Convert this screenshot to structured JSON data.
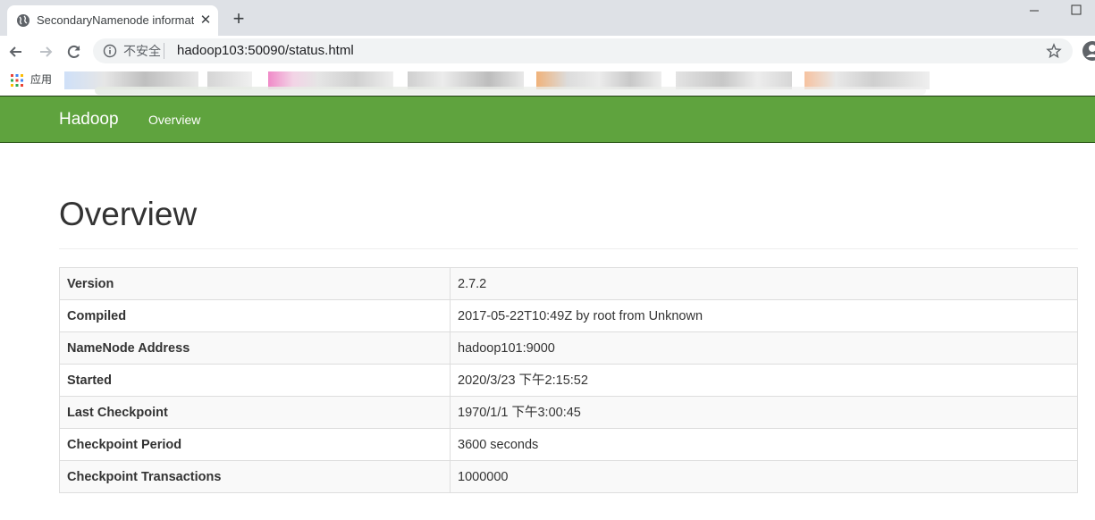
{
  "browser": {
    "tab_title": "SecondaryNamenode information",
    "security_label": "不安全",
    "url": "hadoop103:50090/status.html",
    "bookmarks": {
      "apps_label": "应用"
    }
  },
  "navbar": {
    "brand": "Hadoop",
    "links": [
      {
        "label": "Overview"
      }
    ]
  },
  "overview": {
    "title": "Overview",
    "rows": [
      {
        "label": "Version",
        "value": "2.7.2"
      },
      {
        "label": "Compiled",
        "value": "2017-05-22T10:49Z by root from Unknown"
      },
      {
        "label": "NameNode Address",
        "value": "hadoop101:9000"
      },
      {
        "label": "Started",
        "value": "2020/3/23 下午2:15:52"
      },
      {
        "label": "Last Checkpoint",
        "value": "1970/1/1 下午3:00:45"
      },
      {
        "label": "Checkpoint Period",
        "value": "3600 seconds"
      },
      {
        "label": "Checkpoint Transactions",
        "value": "1000000"
      }
    ]
  },
  "colors": {
    "navbar_bg": "#5fa33e",
    "tabstrip_bg": "#dee1e6"
  }
}
